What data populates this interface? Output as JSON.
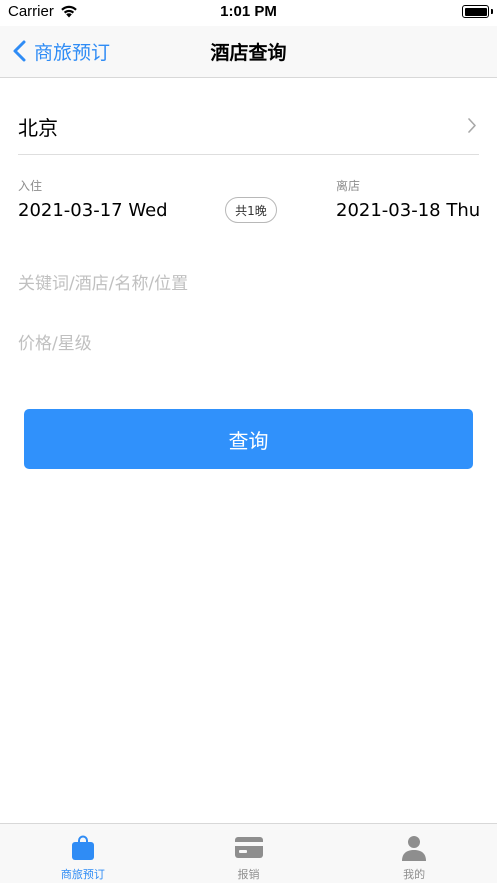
{
  "status_bar": {
    "carrier": "Carrier",
    "time": "1:01 PM",
    "battery_level": 1.0
  },
  "nav": {
    "back_label": "商旅预订",
    "title": "酒店查询"
  },
  "search": {
    "city": "北京",
    "checkin_caption": "入住",
    "checkin_date": "2021-03-17 Wed",
    "nights": "共1晚",
    "checkout_caption": "离店",
    "checkout_date": "2021-03-18 Thu",
    "keyword_placeholder": "关键词/酒店/名称/位置",
    "price_placeholder": "价格/星级",
    "submit_label": "查询"
  },
  "tabs": [
    {
      "label": "商旅预订",
      "icon": "bag-icon",
      "active": true
    },
    {
      "label": "报销",
      "icon": "credit-card-icon",
      "active": false
    },
    {
      "label": "我的",
      "icon": "person-icon",
      "active": false
    }
  ],
  "colors": {
    "accent": "#2f8cf5",
    "button": "#3091fb",
    "inactive": "#8e8e8e",
    "placeholder": "#c0c0c0"
  }
}
